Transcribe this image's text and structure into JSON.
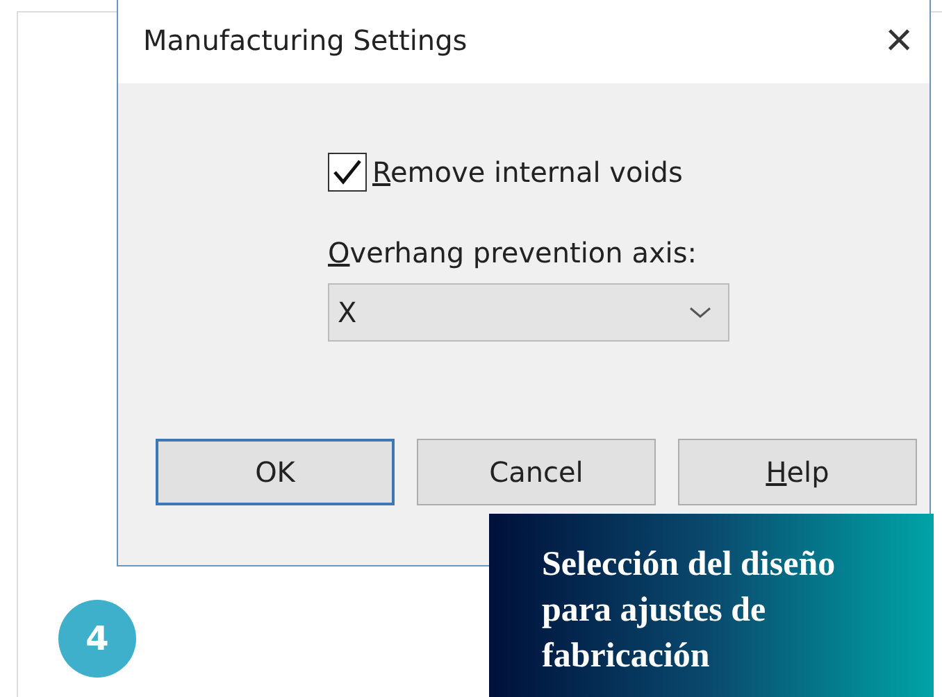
{
  "dialog": {
    "title": "Manufacturing Settings",
    "close": "×",
    "checkbox": {
      "label": "Remove internal voids",
      "checked": true,
      "mnemonic_first": true
    },
    "axis_label": {
      "text": "Overhang prevention axis:",
      "mnemonic_first": true
    },
    "axis_select": {
      "value": "X"
    },
    "buttons": [
      {
        "label": "OK",
        "default": true,
        "mnemonic_first": false
      },
      {
        "label": "Cancel",
        "default": false,
        "mnemonic_first": false
      },
      {
        "label": "Help",
        "default": false,
        "mnemonic_first": true
      }
    ]
  },
  "step": "4",
  "caption": "Selección del diseño para ajustes de fabricación"
}
